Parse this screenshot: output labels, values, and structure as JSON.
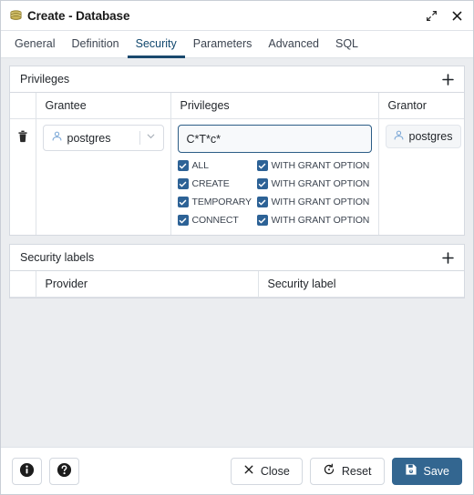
{
  "window": {
    "title": "Create - Database",
    "db_icon": "database-icon",
    "expand_icon": "expand-icon",
    "close_icon": "close-icon"
  },
  "tabs": [
    {
      "label": "General",
      "active": false
    },
    {
      "label": "Definition",
      "active": false
    },
    {
      "label": "Security",
      "active": true
    },
    {
      "label": "Parameters",
      "active": false
    },
    {
      "label": "Advanced",
      "active": false
    },
    {
      "label": "SQL",
      "active": false
    }
  ],
  "privileges_panel": {
    "title": "Privileges",
    "add_icon": "plus-icon",
    "columns": [
      "Grantee",
      "Privileges",
      "Grantor"
    ],
    "rows": [
      {
        "delete_icon": "trash-icon",
        "grantee": {
          "value": "postgres",
          "icon": "user-icon",
          "chevron": "chevron-down-icon"
        },
        "privileges_input": {
          "value": "C*T*c*",
          "placeholder": ""
        },
        "privilege_options": [
          {
            "label": "ALL",
            "checked": true,
            "grant_label": "WITH GRANT OPTION",
            "grant_checked": true
          },
          {
            "label": "CREATE",
            "checked": true,
            "grant_label": "WITH GRANT OPTION",
            "grant_checked": true
          },
          {
            "label": "TEMPORARY",
            "checked": true,
            "grant_label": "WITH GRANT OPTION",
            "grant_checked": true
          },
          {
            "label": "CONNECT",
            "checked": true,
            "grant_label": "WITH GRANT OPTION",
            "grant_checked": true
          }
        ],
        "grantor": {
          "value": "postgres",
          "icon": "user-icon"
        }
      }
    ]
  },
  "security_labels_panel": {
    "title": "Security labels",
    "add_icon": "plus-icon",
    "columns": [
      "Provider",
      "Security label"
    ],
    "rows": []
  },
  "footer": {
    "info_icon": "info-icon",
    "help_icon": "help-icon",
    "close_label": "Close",
    "close_icon": "x-icon",
    "reset_label": "Reset",
    "reset_icon": "reset-icon",
    "save_label": "Save",
    "save_icon": "save-disk-icon"
  },
  "colors": {
    "accent": "#336690",
    "tab_active": "#19486d",
    "checkbox": "#2d6296",
    "body_bg": "#ebedf0",
    "db_icon": "#b8a04a"
  }
}
